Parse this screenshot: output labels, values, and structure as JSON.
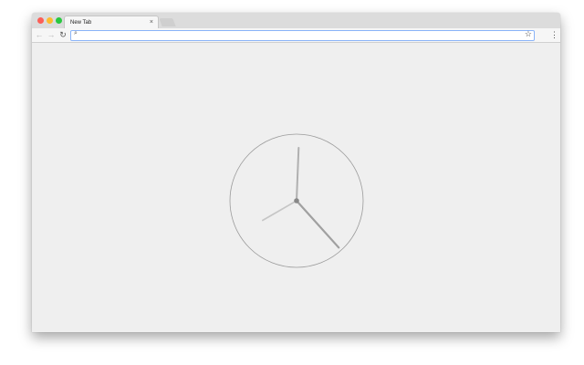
{
  "tabs": [
    {
      "title": "New Tab",
      "close_icon": "close-icon"
    }
  ],
  "omnibox": {
    "value": "",
    "placeholder": ""
  },
  "icons": {
    "back": "arrow-left-icon",
    "forward": "arrow-right-icon",
    "reload": "reload-icon",
    "search": "search-icon",
    "bookmark": "star-icon",
    "menu": "more-vert-icon"
  },
  "glyphs": {
    "close": "×",
    "back": "←",
    "forward": "→",
    "reload": "↻",
    "search": "⌕",
    "star": "☆",
    "menu": "⋮"
  },
  "clock": {
    "hour": 8,
    "minute": 0,
    "second": 23
  },
  "colors": {
    "traffic_close": "#fc5f57",
    "traffic_min": "#fdbc2e",
    "traffic_max": "#28c840",
    "page_background": "#efefef",
    "omnibox_focus": "#8ab4f8"
  }
}
